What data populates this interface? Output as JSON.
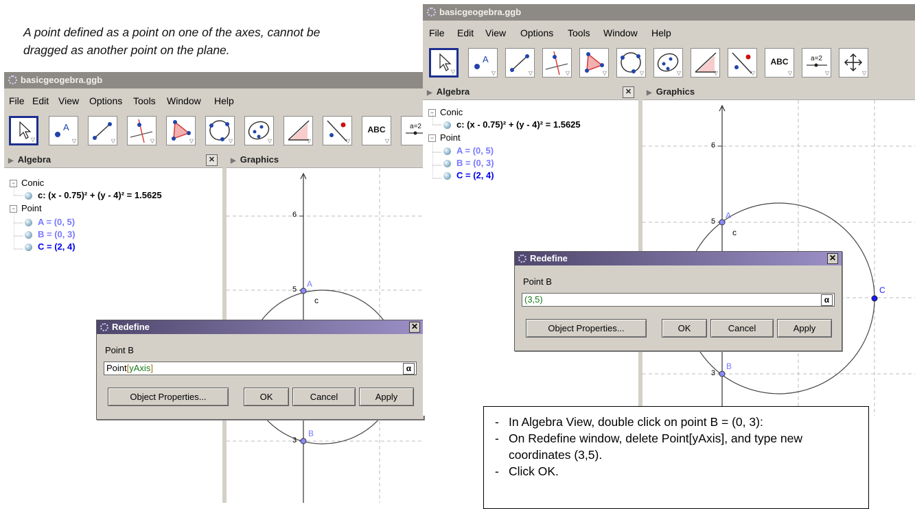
{
  "caption": {
    "line1": "A point defined as a point on one of the axes, cannot be",
    "line2": "dragged as another point on the plane."
  },
  "window": {
    "title": "basicgeogebra.ggb",
    "menu": [
      "File",
      "Edit",
      "View",
      "Options",
      "Tools",
      "Window",
      "Help"
    ],
    "tool_text_abc": "ABC",
    "tool_text_slider": "a=2",
    "panel_algebra": "Algebra",
    "panel_graphics": "Graphics",
    "close_glyph": "✕",
    "tree": {
      "conic_header": "Conic",
      "conic_item": "c: (x - 0.75)² + (y - 4)² = 1.5625",
      "point_header": "Point",
      "point_a": "A = (0, 5)",
      "point_b": "B = (0, 3)",
      "point_c": "C = (2, 4)"
    },
    "graph_labels": {
      "tick_6": "6",
      "tick_5": "5",
      "tick_3": "3",
      "label_a": "A",
      "label_b": "B",
      "label_c": "C",
      "label_conic": "c"
    }
  },
  "dialog_left": {
    "title": "Redefine",
    "label": "Point B",
    "input_prefix": "Point",
    "input_bracket_open": "[",
    "input_arg": "yAxis",
    "input_bracket_close": "]",
    "alpha": "α",
    "buttons": {
      "properties": "Object Properties...",
      "ok": "OK",
      "cancel": "Cancel",
      "apply": "Apply"
    }
  },
  "dialog_right": {
    "title": "Redefine",
    "label": "Point B",
    "input_value": "(3,5)",
    "alpha": "α",
    "buttons": {
      "properties": "Object Properties...",
      "ok": "OK",
      "cancel": "Cancel",
      "apply": "Apply"
    }
  },
  "note": {
    "items": [
      "In Algebra View, double click on point B = (0, 3):",
      "On Redefine window, delete Point[yAxis], and type new coordinates (3,5).",
      "Click OK."
    ]
  },
  "colors": {
    "titlebar": "#8d8a86",
    "chrome": "#d4d0c8",
    "dialog_title_start": "#4f476c",
    "dialog_title_end": "#9b90c6",
    "point_fill": "#7b7bff",
    "point_selected": "#0000ee",
    "grid": "#bbbbbb"
  }
}
